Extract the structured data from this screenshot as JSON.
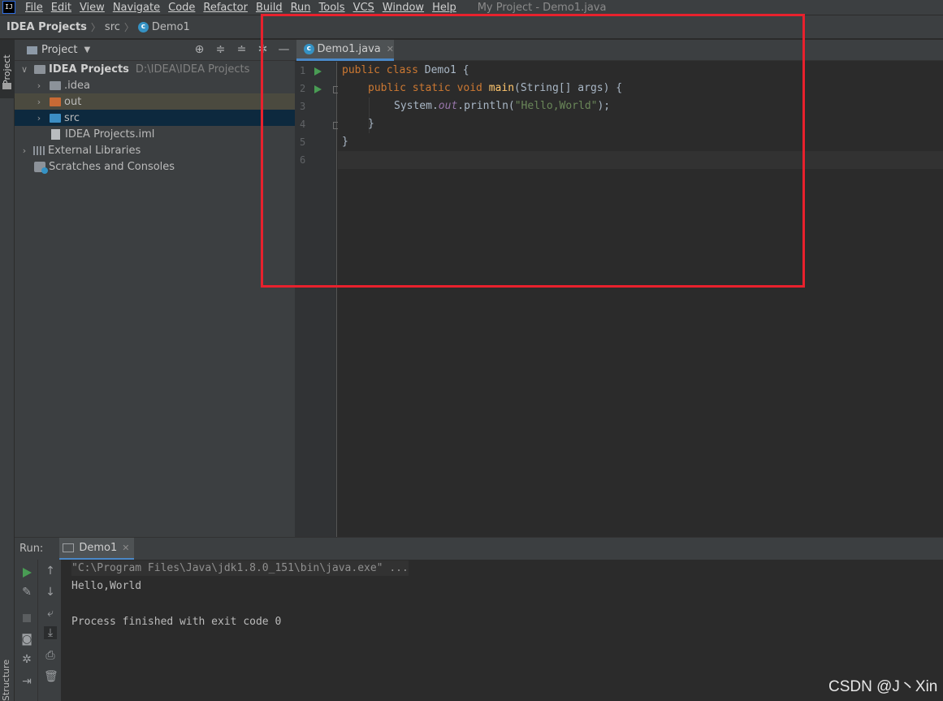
{
  "menubar": {
    "app_icon_text": "IJ",
    "items": [
      "File",
      "Edit",
      "View",
      "Navigate",
      "Code",
      "Refactor",
      "Build",
      "Run",
      "Tools",
      "VCS",
      "Window",
      "Help"
    ],
    "window_title": "My Project - Demo1.java"
  },
  "navbar": {
    "crumbs": [
      "IDEA Projects",
      "src",
      "Demo1"
    ]
  },
  "left_strip": {
    "project_tab": "Project",
    "structure_tab": "Structure"
  },
  "project_panel": {
    "title": "Project",
    "tree": [
      {
        "label": "IDEA Projects",
        "hint": "D:\\IDEA\\IDEA Projects"
      },
      {
        "label": ".idea"
      },
      {
        "label": "out"
      },
      {
        "label": "src"
      },
      {
        "label": "IDEA Projects.iml"
      },
      {
        "label": "External Libraries"
      },
      {
        "label": "Scratches and Consoles"
      }
    ]
  },
  "editor": {
    "tab_label": "Demo1.java",
    "line_numbers": [
      "1",
      "2",
      "3",
      "4",
      "5",
      "6"
    ],
    "code": {
      "l1_kw": "public class ",
      "l1_name": "Demo1 {",
      "l2_kw": "public static void ",
      "l2_fn": "main",
      "l2_rest": "(String[] args) {",
      "l3_obj": "System.",
      "l3_field": "out",
      "l3_call": ".println(",
      "l3_str": "\"Hello,World\"",
      "l3_end": ");",
      "l4": "}",
      "l5": "}"
    }
  },
  "run_panel": {
    "label": "Run:",
    "tab_label": "Demo1",
    "console": {
      "command": "\"C:\\Program Files\\Java\\jdk1.8.0_151\\bin\\java.exe\" ...",
      "output": "Hello,World",
      "exit": "Process finished with exit code 0"
    }
  },
  "watermark": "CSDN @J丶Xin",
  "colors": {
    "highlight_box": "#e8212d",
    "keyword": "#cc7832",
    "string": "#6a8759",
    "method": "#ffc66d",
    "accent": "#4a88c7"
  }
}
